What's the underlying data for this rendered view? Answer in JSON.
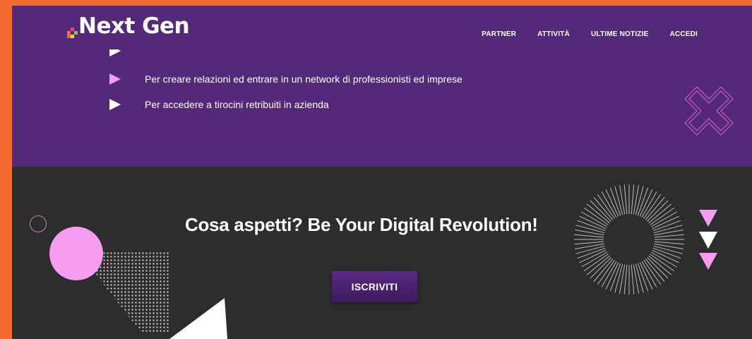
{
  "brand": {
    "name": "Next Gen",
    "colors": {
      "page_frame": "#f26a2e",
      "header_bg": "#55297a",
      "section_bg": "#2d2d2d",
      "accent_pink": "#f79cf0"
    }
  },
  "nav": {
    "items": [
      {
        "label": "PARTNER"
      },
      {
        "label": "ATTIVITÀ"
      },
      {
        "label": "ULTIME NOTIZIE"
      },
      {
        "label": "ACCEDI"
      }
    ]
  },
  "benefits": {
    "items": [
      {
        "text": "Per creare relazioni ed entrare in un network di professionisti ed imprese",
        "bullet": "pink-triangle-icon"
      },
      {
        "text": "Per accedere a tirocini retribuiti in azienda",
        "bullet": "white-triangle-icon"
      }
    ]
  },
  "cta": {
    "title": "Cosa aspetti? Be Your Digital Revolution!",
    "button_label": "ISCRIVITI"
  },
  "icons": [
    "logo-pixel-icon",
    "x-outline-icon",
    "sunburst-icon",
    "triangle-stack-icon",
    "ring-icon",
    "pink-circle-shape",
    "dot-grid-pattern",
    "mouse-cursor-icon"
  ]
}
